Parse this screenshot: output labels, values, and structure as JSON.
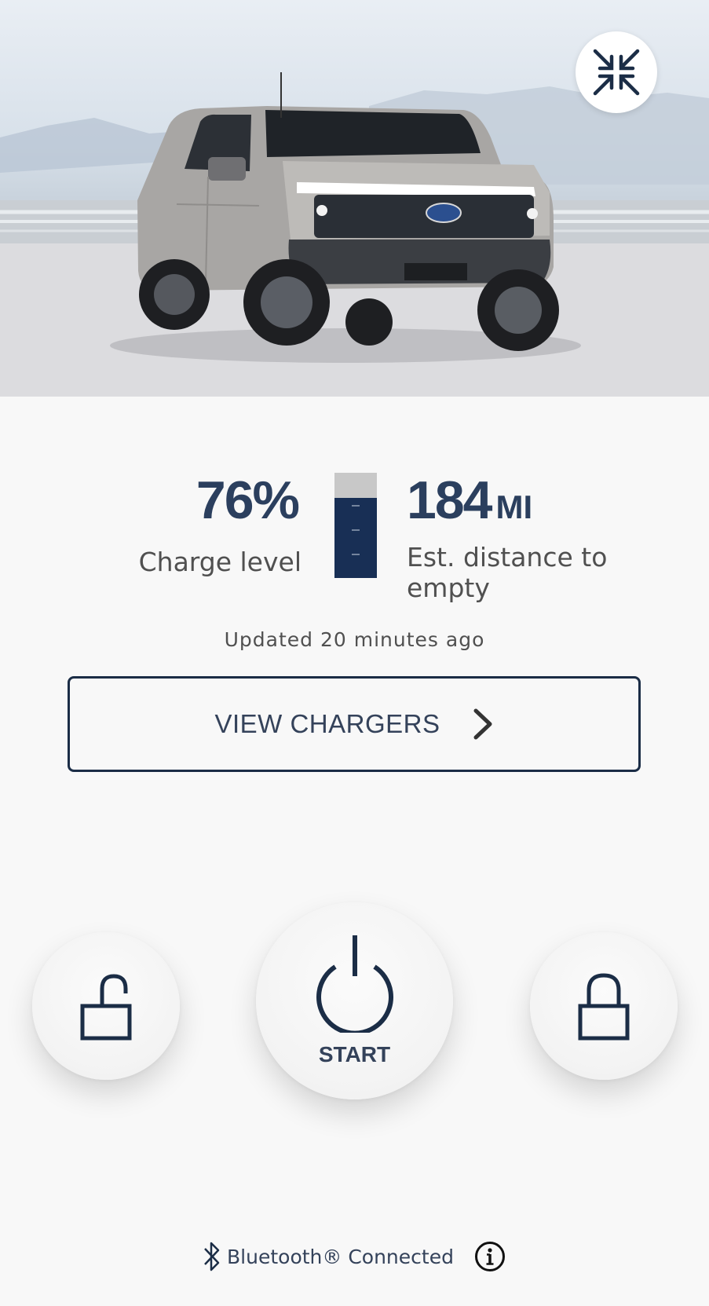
{
  "header": {
    "collapse_icon": "collapse-arrows-icon"
  },
  "vehicle": {
    "image_alt": "Electric pickup truck"
  },
  "charge": {
    "value": "76%",
    "label": "Charge level"
  },
  "battery": {
    "icon": "battery-icon",
    "level_fraction": 0.76,
    "fill_color": "#182f55",
    "empty_color": "#c8c8c8"
  },
  "range": {
    "value": "184",
    "unit": "MI",
    "label": "Est. distance to empty"
  },
  "updated_text": "Updated 20 minutes ago",
  "chargers_button": {
    "label": "VIEW CHARGERS",
    "icon": "chevron-right-icon"
  },
  "controls": {
    "unlock_icon": "unlock-icon",
    "start_label": "START",
    "start_icon": "power-icon",
    "lock_icon": "lock-icon"
  },
  "status": {
    "bluetooth_icon": "bluetooth-icon",
    "bluetooth_text": "Bluetooth® Connected",
    "info_icon": "info-icon"
  },
  "colors": {
    "accent": "#2b3f5e",
    "navy": "#1b2d46",
    "background": "#f8f8f8"
  }
}
